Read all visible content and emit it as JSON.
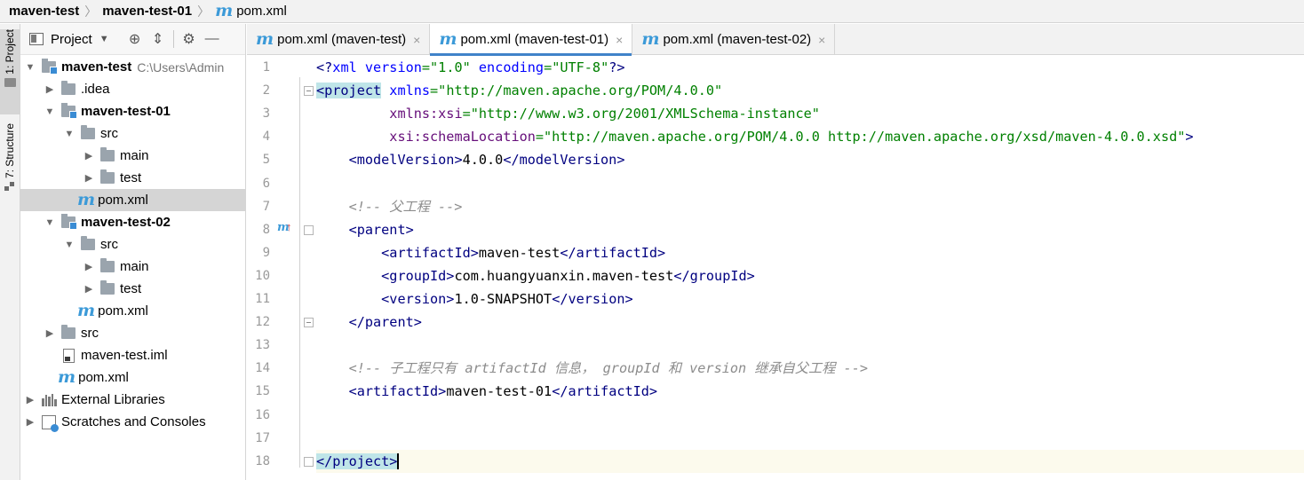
{
  "breadcrumb": {
    "items": [
      "maven-test",
      "maven-test-01",
      "pom.xml"
    ],
    "separator": "〉"
  },
  "side_strip": {
    "project_tab": "1: Project",
    "structure_tab": "7: Structure"
  },
  "project_panel": {
    "title": "Project",
    "tree": [
      {
        "label": "maven-test",
        "hint": "C:\\Users\\Admin",
        "type": "module",
        "bold": true,
        "arrow": "down",
        "depth": 0
      },
      {
        "label": ".idea",
        "type": "folder",
        "arrow": "right",
        "depth": 1
      },
      {
        "label": "maven-test-01",
        "type": "module",
        "bold": true,
        "arrow": "down",
        "depth": 1
      },
      {
        "label": "src",
        "type": "folder",
        "arrow": "down",
        "depth": 2
      },
      {
        "label": "main",
        "type": "folder",
        "arrow": "right",
        "depth": 3
      },
      {
        "label": "test",
        "type": "folder",
        "arrow": "right",
        "depth": 3
      },
      {
        "label": "pom.xml",
        "type": "maven",
        "arrow": "none",
        "depth": 2,
        "selected": true
      },
      {
        "label": "maven-test-02",
        "type": "module",
        "bold": true,
        "arrow": "down",
        "depth": 1
      },
      {
        "label": "src",
        "type": "folder",
        "arrow": "down",
        "depth": 2
      },
      {
        "label": "main",
        "type": "folder",
        "arrow": "right",
        "depth": 3
      },
      {
        "label": "test",
        "type": "folder",
        "arrow": "right",
        "depth": 3
      },
      {
        "label": "pom.xml",
        "type": "maven",
        "arrow": "none",
        "depth": 2
      },
      {
        "label": "src",
        "type": "folder",
        "arrow": "right",
        "depth": 1
      },
      {
        "label": "maven-test.iml",
        "type": "iml",
        "arrow": "none",
        "depth": 1
      },
      {
        "label": "pom.xml",
        "type": "maven",
        "arrow": "none",
        "depth": 1
      },
      {
        "label": "External Libraries",
        "type": "libs",
        "arrow": "right",
        "depth": 0
      },
      {
        "label": "Scratches and Consoles",
        "type": "scratch",
        "arrow": "right",
        "depth": 0
      }
    ]
  },
  "tabs": [
    {
      "label": "pom.xml (maven-test)",
      "active": false
    },
    {
      "label": "pom.xml (maven-test-01)",
      "active": true
    },
    {
      "label": "pom.xml (maven-test-02)",
      "active": false
    }
  ],
  "tab_close_glyph": "×",
  "editor": {
    "line_numbers": [
      "1",
      "2",
      "3",
      "4",
      "5",
      "6",
      "7",
      "8",
      "9",
      "10",
      "11",
      "12",
      "13",
      "14",
      "15",
      "16",
      "17",
      "18"
    ],
    "gutter_markers": {
      "line": 8,
      "m": "m",
      "arrow": "↑"
    },
    "lines": [
      [
        {
          "c": "t",
          "v": "<?"
        },
        {
          "c": "a",
          "v": "xml version"
        },
        {
          "c": "s",
          "v": "=\"1.0\""
        },
        {
          "c": "a",
          "v": " encoding"
        },
        {
          "c": "s",
          "v": "=\"UTF-8\""
        },
        {
          "c": "t",
          "v": "?>"
        }
      ],
      [
        {
          "c": "t hl",
          "v": "<project"
        },
        {
          "c": "a",
          "v": " xmlns"
        },
        {
          "c": "s",
          "v": "=\"http://maven.apache.org/POM/4.0.0\""
        }
      ],
      [
        {
          "c": "",
          "v": "         "
        },
        {
          "c": "ns",
          "v": "xmlns:xsi"
        },
        {
          "c": "s",
          "v": "=\"http://www.w3.org/2001/XMLSchema-instance\""
        }
      ],
      [
        {
          "c": "",
          "v": "         "
        },
        {
          "c": "ns",
          "v": "xsi:schemaLocation"
        },
        {
          "c": "s",
          "v": "=\"http://maven.apache.org/POM/4.0.0 http://maven.apache.org/xsd/maven-4.0.0.xsd\""
        },
        {
          "c": "t",
          "v": ">"
        }
      ],
      [
        {
          "c": "",
          "v": "    "
        },
        {
          "c": "t",
          "v": "<modelVersion>"
        },
        {
          "c": "",
          "v": "4.0.0"
        },
        {
          "c": "t",
          "v": "</modelVersion>"
        }
      ],
      [],
      [
        {
          "c": "",
          "v": "    "
        },
        {
          "c": "c",
          "v": "<!-- 父工程 -->"
        }
      ],
      [
        {
          "c": "",
          "v": "    "
        },
        {
          "c": "t",
          "v": "<parent>"
        }
      ],
      [
        {
          "c": "",
          "v": "        "
        },
        {
          "c": "t",
          "v": "<artifactId>"
        },
        {
          "c": "",
          "v": "maven-test"
        },
        {
          "c": "t",
          "v": "</artifactId>"
        }
      ],
      [
        {
          "c": "",
          "v": "        "
        },
        {
          "c": "t",
          "v": "<groupId>"
        },
        {
          "c": "",
          "v": "com.huangyuanxin.maven-test"
        },
        {
          "c": "t",
          "v": "</groupId>"
        }
      ],
      [
        {
          "c": "",
          "v": "        "
        },
        {
          "c": "t",
          "v": "<version>"
        },
        {
          "c": "",
          "v": "1.0-SNAPSHOT"
        },
        {
          "c": "t",
          "v": "</version>"
        }
      ],
      [
        {
          "c": "",
          "v": "    "
        },
        {
          "c": "t",
          "v": "</parent>"
        }
      ],
      [],
      [
        {
          "c": "",
          "v": "    "
        },
        {
          "c": "c",
          "v": "<!-- 子工程只有 artifactId 信息， groupId 和 version 继承自父工程 -->"
        }
      ],
      [
        {
          "c": "",
          "v": "    "
        },
        {
          "c": "t",
          "v": "<artifactId>"
        },
        {
          "c": "",
          "v": "maven-test-01"
        },
        {
          "c": "t",
          "v": "</artifactId>"
        }
      ],
      [],
      [],
      [
        {
          "c": "t hl",
          "v": "</project>"
        }
      ]
    ],
    "current_line": 18
  }
}
